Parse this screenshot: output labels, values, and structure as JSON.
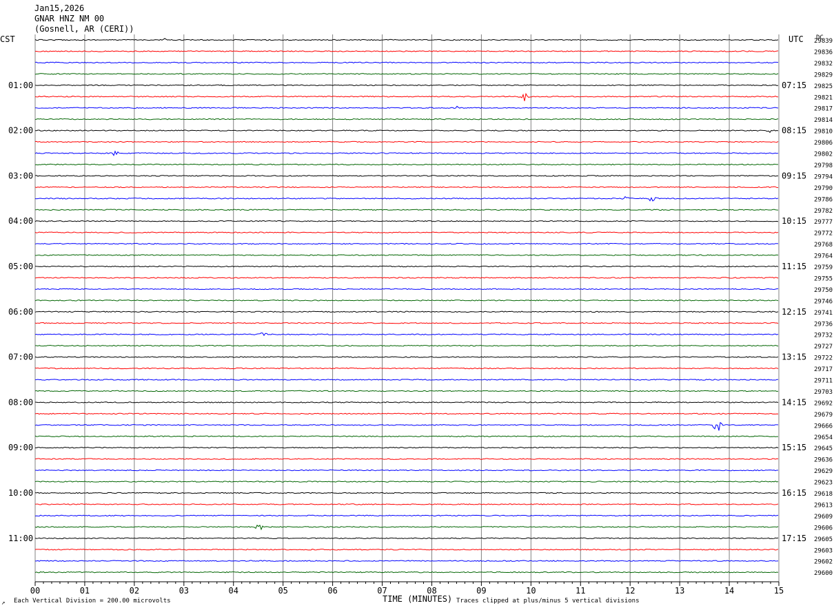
{
  "header": {
    "date": "Jan15,2026",
    "station": "GNAR HNZ NM 00",
    "location": "(Gosnell, AR (CERI))"
  },
  "left_zone": "CST",
  "right_zone": "UTC",
  "dc_label": "DC",
  "footer": {
    "scale_note": "Each Vertical Division =  200.00 microvolts",
    "corner_mark": "↗",
    "xlabel": "TIME (MINUTES)",
    "clip_note": "Traces clipped at plus/minus 5 vertical divisions"
  },
  "colors": {
    "trace_cycle": [
      "#000000",
      "#ff0000",
      "#0000ff",
      "#006400"
    ],
    "grid": "#808080"
  },
  "chart_data": {
    "type": "line",
    "title": "GNAR HNZ NM 00",
    "xlabel": "TIME (MINUTES)",
    "xlim": [
      0,
      15
    ],
    "xticks": [
      "00",
      "01",
      "02",
      "03",
      "04",
      "05",
      "06",
      "07",
      "08",
      "09",
      "10",
      "11",
      "12",
      "13",
      "14",
      "15"
    ],
    "cst_labels": [
      "01:00",
      "02:00",
      "03:00",
      "04:00",
      "05:00",
      "06:00",
      "07:00",
      "08:00",
      "09:00",
      "10:00",
      "11:00"
    ],
    "utc_labels": [
      "07:15",
      "08:15",
      "09:15",
      "10:15",
      "11:15",
      "12:15",
      "13:15",
      "14:15",
      "15:15",
      "16:15",
      "17:15"
    ],
    "dc_values": [
      "29839",
      "29836",
      "29832",
      "29829",
      "29825",
      "29821",
      "29817",
      "29814",
      "29810",
      "29806",
      "29802",
      "29798",
      "29794",
      "29790",
      "29786",
      "29782",
      "29777",
      "29772",
      "29768",
      "29764",
      "29759",
      "29755",
      "29750",
      "29746",
      "29741",
      "29736",
      "29732",
      "29727",
      "29722",
      "29717",
      "29711",
      "29703",
      "29692",
      "29679",
      "29666",
      "29654",
      "29645",
      "29636",
      "29629",
      "29623",
      "29618",
      "29613",
      "29609",
      "29606",
      "29605",
      "29603",
      "29602",
      "29600"
    ],
    "events": [
      {
        "row": 0,
        "minute": 2.6,
        "amp": 3
      },
      {
        "row": 5,
        "minute": 9.85,
        "amp": 8
      },
      {
        "row": 6,
        "minute": 8.55,
        "amp": 3
      },
      {
        "row": 8,
        "minute": 14.85,
        "amp": 3
      },
      {
        "row": 10,
        "minute": 1.6,
        "amp": 4
      },
      {
        "row": 14,
        "minute": 11.9,
        "amp": 4
      },
      {
        "row": 14,
        "minute": 12.45,
        "amp": 5
      },
      {
        "row": 26,
        "minute": 4.6,
        "amp": 3
      },
      {
        "row": 34,
        "minute": 13.75,
        "amp": 12
      },
      {
        "row": 43,
        "minute": 4.5,
        "amp": 7
      }
    ]
  }
}
